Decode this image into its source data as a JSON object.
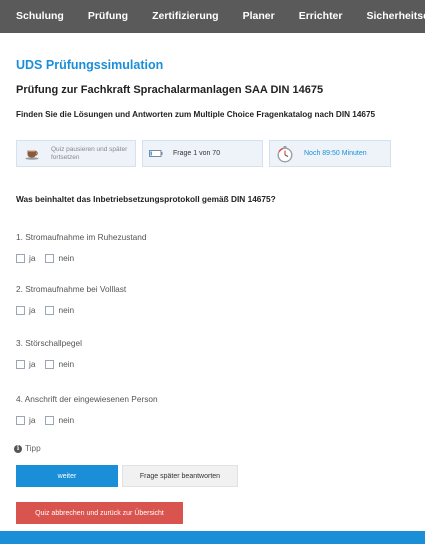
{
  "nav": {
    "items": [
      "Schulung",
      "Prüfung",
      "Zertifizierung",
      "Planer",
      "Errichter",
      "Sicherheitsdien"
    ]
  },
  "page": {
    "app_title": "UDS Prüfungssimulation",
    "quiz_title": "Prüfung zur Fachkraft Sprachalarmanlagen SAA DIN 14675",
    "subtitle": "Finden Sie die Lösungen und Antworten zum Multiple Choice Fragenkatalog nach DIN 14675"
  },
  "infobar": {
    "pause_label": "Quiz pausieren und später fortsetzen",
    "pause_icon": "coffee-cup-icon",
    "progress_label": "Frage 1 von 70",
    "progress_icon": "battery-icon",
    "progress_fraction": 0.014,
    "timer_label": "Noch 89:50 Minuten",
    "timer_icon": "stopwatch-icon"
  },
  "question": {
    "text": "Was beinhaltet das Inbetriebsetzungsprotokoll gemäß DIN 14675?",
    "answers": [
      {
        "label": "1. Stromaufnahme im Ruhezustand",
        "yes": "ja",
        "no": "nein"
      },
      {
        "label": "2. Stromaufnahme bei Volllast",
        "yes": "ja",
        "no": "nein"
      },
      {
        "label": "3. Störschallpegel",
        "yes": "ja",
        "no": "nein"
      },
      {
        "label": "4. Anschrift der eingewiesenen Person",
        "yes": "ja",
        "no": "nein"
      }
    ]
  },
  "tipp": {
    "label": "Tipp",
    "icon": "info-icon"
  },
  "buttons": {
    "next": "weiter",
    "later": "Frage später beantworten",
    "abort": "Quiz abbrechen und zurück zur Übersicht"
  },
  "colors": {
    "accent": "#1a8fd8",
    "nav_bg": "#5a5a5a",
    "danger": "#d9534f"
  }
}
